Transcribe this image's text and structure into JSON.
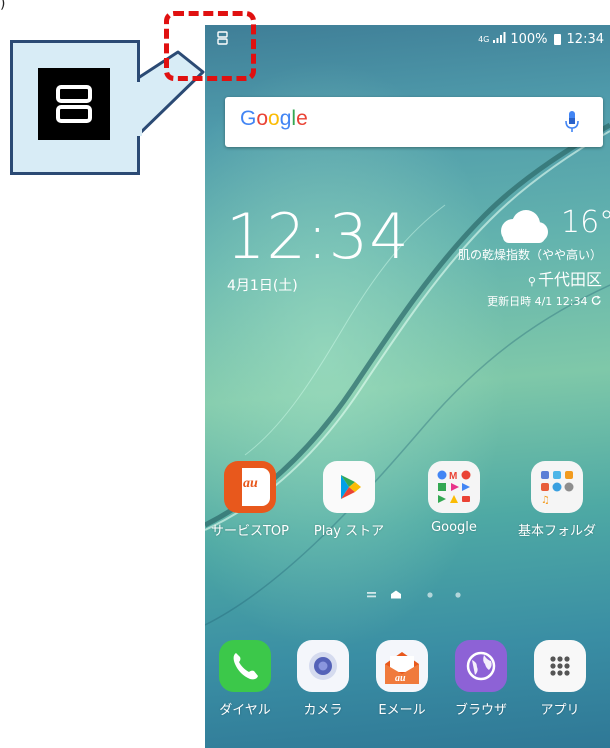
{
  "callout": {
    "icon": "split-screen-icon"
  },
  "status": {
    "left_icon": "split-screen-icon",
    "network": "4G",
    "signal_icon": "signal-icon",
    "battery": "100%",
    "time": "12:34"
  },
  "search": {
    "logo": "Google",
    "mic_icon": "mic-icon",
    "logo_colors": [
      "#4285f4",
      "#ea4335",
      "#fbbc05",
      "#4285f4",
      "#34a853",
      "#ea4335"
    ]
  },
  "widget": {
    "time": "12:34",
    "date": "4月1日(土)",
    "weather_icon": "cloud-icon",
    "temperature": "16°",
    "skin_index": "肌の乾燥指数（やや高い）",
    "location": "千代田区",
    "updated": "更新日時 4/1 12:34",
    "refresh_icon": "refresh-icon"
  },
  "apps": [
    {
      "label": "サービスTOP",
      "icon": "au-service-icon",
      "badge": "au"
    },
    {
      "label": "Play ストア",
      "icon": "play-store-icon"
    },
    {
      "label": "Google",
      "icon": "google-folder-icon"
    },
    {
      "label": "基本フォルダ",
      "icon": "basic-folder-icon"
    }
  ],
  "page_indicator": {
    "pages": 4,
    "current": 1
  },
  "dock": [
    {
      "label": "ダイヤル",
      "icon": "phone-icon"
    },
    {
      "label": "カメラ",
      "icon": "camera-icon"
    },
    {
      "label": "Eメール",
      "icon": "email-icon",
      "badge": "au"
    },
    {
      "label": "ブラウザ",
      "icon": "browser-icon"
    },
    {
      "label": "アプリ",
      "icon": "apps-grid-icon"
    }
  ],
  "colors": {
    "callout_bg": "#d8ecf6",
    "callout_border": "#2b4a74",
    "highlight": "#e01010",
    "au_orange": "#e8581c"
  }
}
